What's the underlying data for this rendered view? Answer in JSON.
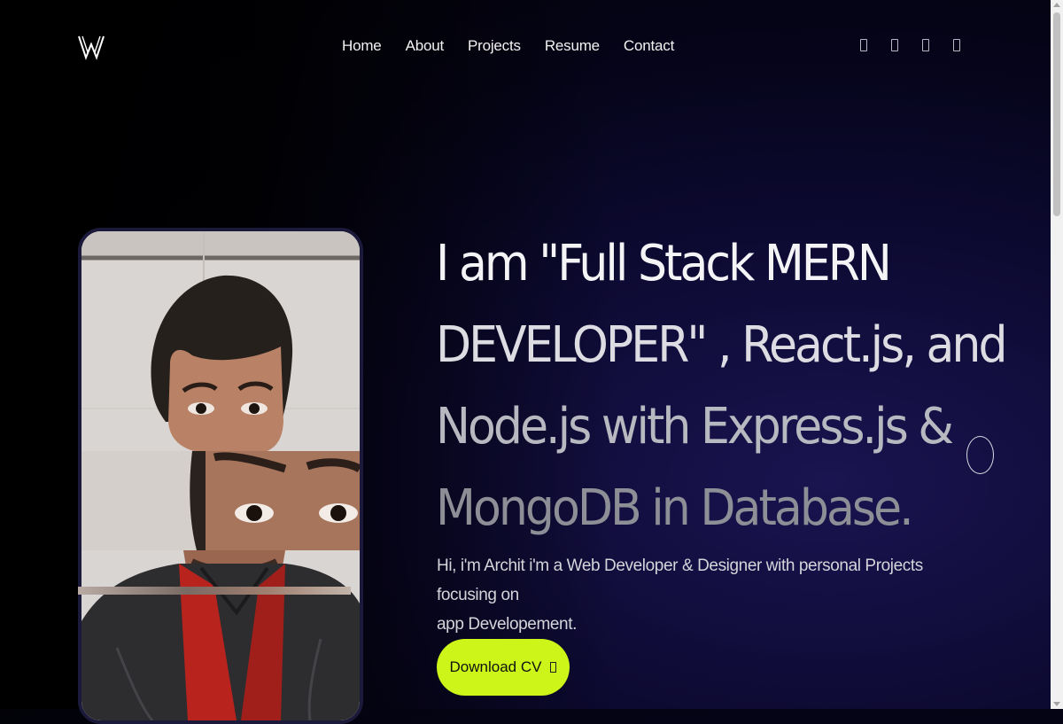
{
  "nav": {
    "logo": "logo-w",
    "links": [
      "Home",
      "About",
      "Projects",
      "Resume",
      "Contact"
    ],
    "social_icons": [
      "social-icon-1",
      "social-icon-2",
      "social-icon-3",
      "social-icon-4"
    ]
  },
  "hero": {
    "headline_lines": [
      "I am \"Full Stack MERN",
      "DEVELOPER\" , React.js, and",
      "Node.js with Express.js &",
      "MongoDB in Database."
    ],
    "intro_line_1": "Hi, i'm Archit i'm a Web Developer & Designer with personal Projects focusing on",
    "intro_line_2": "app Developement.",
    "cv_button": "Download CV",
    "cv_icon": "download-icon"
  },
  "colors": {
    "accent": "#cdf51a",
    "background": "#0d0a33"
  }
}
